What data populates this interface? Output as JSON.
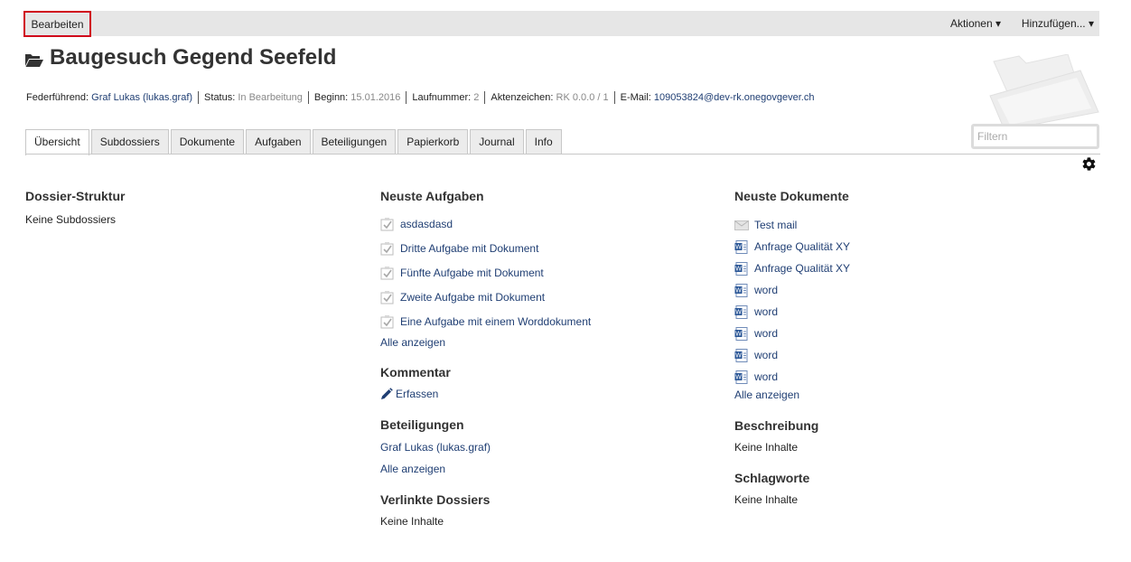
{
  "toolbar": {
    "edit_label": "Bearbeiten",
    "actions_label": "Aktionen ▾",
    "add_label": "Hinzufügen... ▾"
  },
  "dossier": {
    "title": "Baugesuch Gegend Seefeld",
    "meta": {
      "lead_label": "Federführend:",
      "lead_value": "Graf Lukas (lukas.graf)",
      "status_label": "Status:",
      "status_value": "In Bearbeitung",
      "start_label": "Beginn:",
      "start_value": "15.01.2016",
      "number_label": "Laufnummer:",
      "number_value": "2",
      "reference_label": "Aktenzeichen:",
      "reference_value": "RK 0.0.0 / 1",
      "email_label": "E-Mail:",
      "email_value": "109053824@dev-rk.onegovgever.ch"
    }
  },
  "tabs": [
    "Übersicht",
    "Subdossiers",
    "Dokumente",
    "Aufgaben",
    "Beteiligungen",
    "Papierkorb",
    "Journal",
    "Info"
  ],
  "filter": {
    "placeholder": "Filtern"
  },
  "structure": {
    "heading": "Dossier-Struktur",
    "empty": "Keine Subdossiers"
  },
  "tasks": {
    "heading": "Neuste Aufgaben",
    "items": [
      "asdasdasd",
      "Dritte Aufgabe mit Dokument",
      "Fünfte Aufgabe mit Dokument",
      "Zweite Aufgabe mit Dokument",
      "Eine Aufgabe mit einem Worddokument"
    ],
    "show_all": "Alle anzeigen"
  },
  "comment": {
    "heading": "Kommentar",
    "action": "Erfassen"
  },
  "participations": {
    "heading": "Beteiligungen",
    "person": "Graf Lukas (lukas.graf)",
    "show_all": "Alle anzeigen"
  },
  "linked": {
    "heading": "Verlinkte Dossiers",
    "empty": "Keine Inhalte"
  },
  "documents": {
    "heading": "Neuste Dokumente",
    "items": [
      {
        "title": "Test mail",
        "icon": "mail-icon"
      },
      {
        "title": "Anfrage Qualität XY",
        "icon": "word-document-icon"
      },
      {
        "title": "Anfrage Qualität XY",
        "icon": "word-document-icon"
      },
      {
        "title": "word",
        "icon": "word-document-icon"
      },
      {
        "title": "word",
        "icon": "word-document-icon"
      },
      {
        "title": "word",
        "icon": "word-document-icon"
      },
      {
        "title": "word",
        "icon": "word-document-icon"
      },
      {
        "title": "word",
        "icon": "word-document-icon"
      }
    ],
    "show_all": "Alle anzeigen"
  },
  "description": {
    "heading": "Beschreibung",
    "empty": "Keine Inhalte"
  },
  "keywords": {
    "heading": "Schlagworte",
    "empty": "Keine Inhalte"
  }
}
